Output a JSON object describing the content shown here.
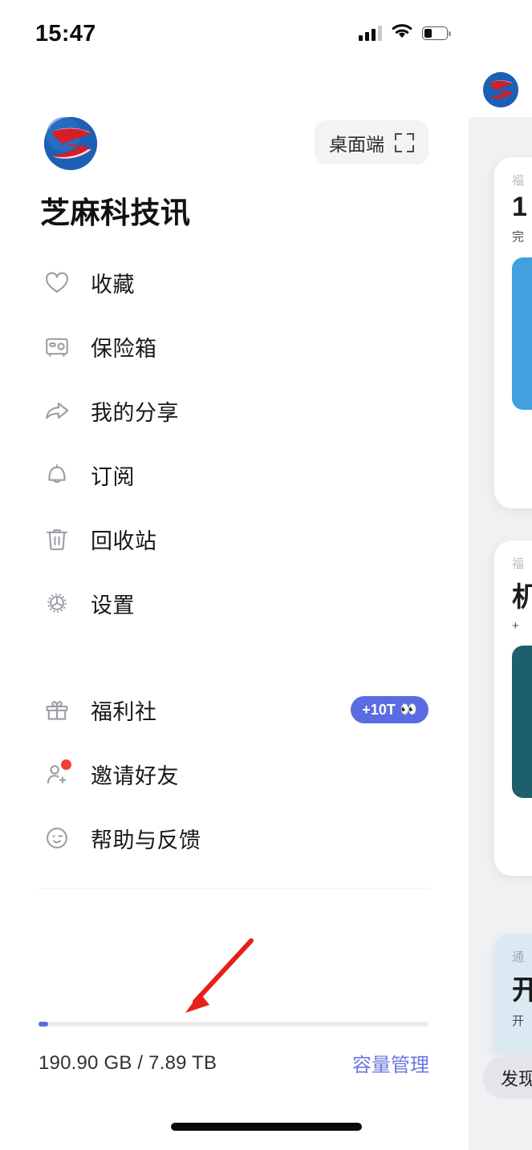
{
  "status_bar": {
    "time": "15:47",
    "signal_icon": "cellular-signal-icon",
    "signal_bars_filled": 3,
    "signal_bars_total": 4,
    "wifi_icon": "wifi-icon",
    "battery_icon": "battery-icon",
    "battery_percent": 35
  },
  "header": {
    "logo_icon": "app-logo-icon",
    "desktop_button": {
      "label": "桌面端",
      "icon": "scan-frame-icon"
    },
    "username": "芝麻科技讯"
  },
  "menu": {
    "primary": [
      {
        "label": "收藏",
        "icon": "heart-icon"
      },
      {
        "label": "保险箱",
        "icon": "safe-box-icon"
      },
      {
        "label": "我的分享",
        "icon": "share-arrow-icon"
      },
      {
        "label": "订阅",
        "icon": "bell-icon"
      },
      {
        "label": "回收站",
        "icon": "trash-icon"
      },
      {
        "label": "设置",
        "icon": "gear-icon"
      }
    ],
    "secondary": [
      {
        "label": "福利社",
        "icon": "gift-icon",
        "badge": {
          "text": "+10T",
          "emoji": "👀"
        }
      },
      {
        "label": "邀请好友",
        "icon": "add-user-icon",
        "dot": true
      },
      {
        "label": "帮助与反馈",
        "icon": "smiley-wink-icon"
      }
    ]
  },
  "storage": {
    "used_total_text": "190.90 GB / 7.89 TB",
    "manage_link": "容量管理",
    "used_percent": 2.4
  },
  "background_app": {
    "logo_icon": "app-logo-icon",
    "cards": [
      {
        "category": "福",
        "title": "1",
        "subtitle": "完"
      },
      {
        "category": "福",
        "title": "机",
        "subtitle": "+"
      },
      {
        "category": "通",
        "title": "开",
        "subtitle": "开"
      }
    ],
    "discover_pill": "发现"
  },
  "annotation": {
    "arrow_icon": "red-pointer-arrow-icon",
    "color": "#e8201a"
  },
  "colors": {
    "accent": "#5a6ce0",
    "link": "#6b78dd",
    "badge_bg": "#5b6ce2",
    "red_dot": "#ef4136",
    "icon_stroke": "#9b9ea4",
    "text": "#17181a"
  }
}
